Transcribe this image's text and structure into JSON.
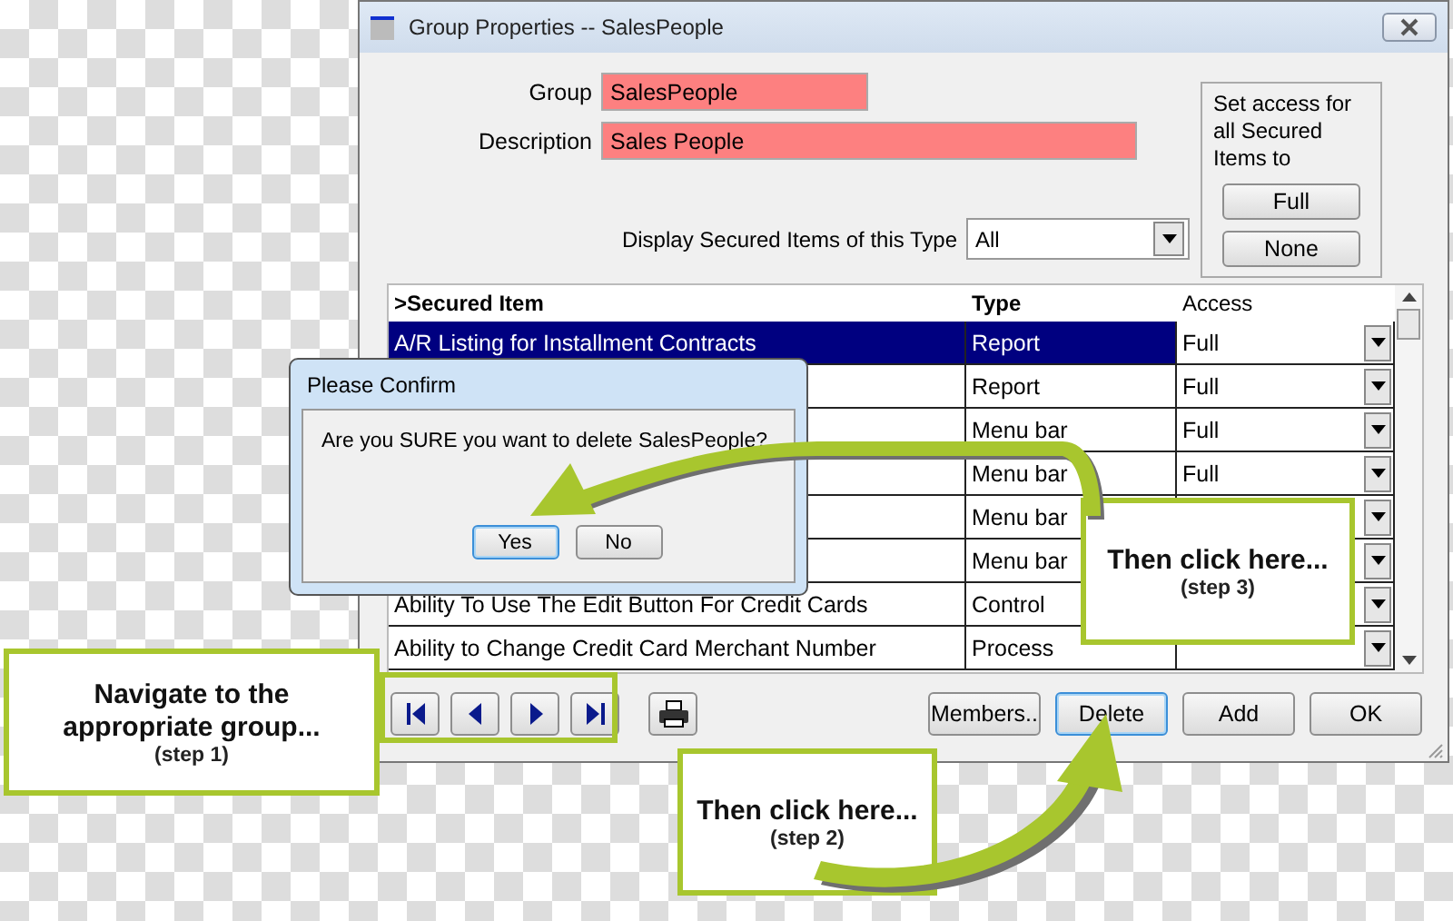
{
  "window": {
    "title": "Group Properties -- SalesPeople"
  },
  "form": {
    "group": {
      "label": "Group",
      "value": "SalesPeople"
    },
    "description": {
      "label": "Description",
      "value": "Sales People"
    }
  },
  "access_box": {
    "text": "Set access for all Secured Items to",
    "buttons": [
      "Full",
      "None"
    ]
  },
  "filter": {
    "label": "Display Secured Items of this Type",
    "value": "All"
  },
  "table": {
    "columns": [
      ">Secured Item",
      "Type",
      "Access"
    ],
    "rows": [
      {
        "item": "A/R Listing for Installment Contracts",
        "type": "Report",
        "access": "Full",
        "selected": true
      },
      {
        "type": "Report",
        "access": "Full",
        "selected": false
      },
      {
        "type": "Menu bar",
        "access": "Full",
        "selected": false
      },
      {
        "type": "Menu bar",
        "access": "Full",
        "selected": false
      },
      {
        "type": "Menu bar",
        "selected": false
      },
      {
        "type": "Menu bar",
        "selected": false
      },
      {
        "item": "Ability To Use The Edit Button For Credit Cards",
        "type": "Control",
        "selected": false
      },
      {
        "item": "Ability to Change Credit Card Merchant Number",
        "type": "Process",
        "selected": false
      }
    ]
  },
  "buttons": [
    {
      "label": "Members..",
      "focused": false
    },
    {
      "label": "Delete",
      "focused": true
    },
    {
      "label": "Add",
      "focused": false
    },
    {
      "label": "OK",
      "focused": false
    }
  ],
  "dialog": {
    "title": "Please Confirm",
    "message": "Are you SURE you want to delete SalesPeople?",
    "buttons": [
      {
        "label": "Yes",
        "focused": true
      },
      {
        "label": "No",
        "focused": false
      }
    ]
  },
  "callouts": [
    {
      "title": "Navigate to the appropriate group...",
      "step": "(step 1)"
    },
    {
      "title": "Then click here...",
      "step": "(step 2)"
    },
    {
      "title": "Then click here...",
      "step": "(step 3)"
    }
  ]
}
